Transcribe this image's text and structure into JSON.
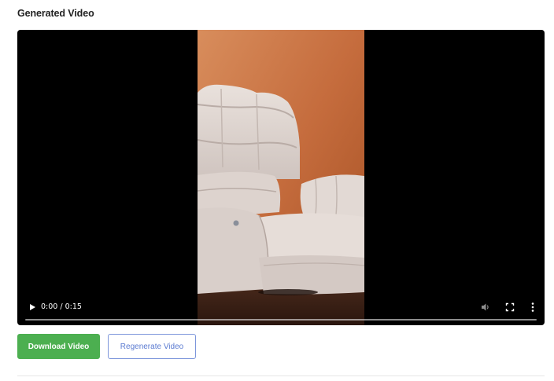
{
  "section": {
    "title": "Generated Video"
  },
  "video": {
    "current_time": "0:00",
    "duration": "0:15",
    "time_display": "0:00 / 0:15",
    "progress": 0,
    "content": "beige leather recliner chair against orange wall"
  },
  "icons": {
    "play": "play-icon",
    "volume": "volume-icon",
    "fullscreen": "fullscreen-icon",
    "more": "more-options-icon"
  },
  "actions": {
    "download_label": "Download Video",
    "regenerate_label": "Regenerate Video"
  },
  "colors": {
    "download_bg": "#4caf50",
    "regenerate_text": "#5a7ad1",
    "regenerate_border": "#7d96db",
    "player_bg": "#000000"
  }
}
